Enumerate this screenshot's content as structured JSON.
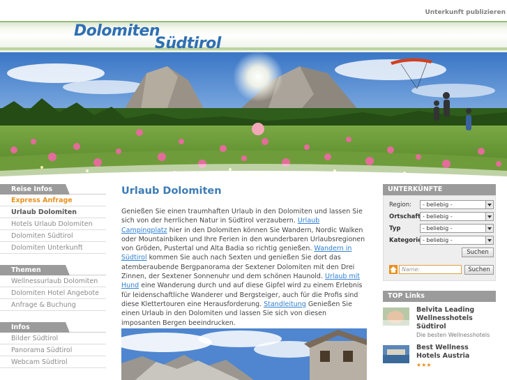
{
  "header": {
    "publish_link": "Unterkunft publizieren",
    "logo_line1": "Dolomiten",
    "logo_line2": "Südtirol"
  },
  "leftnav": {
    "sections": [
      {
        "title": "Reise Infos",
        "items": [
          "Express Anfrage",
          "Urlaub Dolomiten",
          "Hotels Urlaub Dolomiten",
          "Dolomiten Südtirol",
          "Dolomiten Unterkunft"
        ]
      },
      {
        "title": "Themen",
        "items": [
          "Wellnessurlaub Dolomiten",
          "Dolomiten Hotel Angebote",
          "Anfrage & Buchung"
        ]
      },
      {
        "title": "Infos",
        "items": [
          "Bilder Südtirol",
          "Panorama Südtirol",
          "Webcam Südtirol"
        ]
      }
    ]
  },
  "main": {
    "title": "Urlaub Dolomiten",
    "t1": "Genießen Sie einen traumhaften Urlaub in den Dolomiten und lassen Sie sich von der herrlichen Natur in Südtirol verzaubern. ",
    "l1": "Urlaub Campingplatz",
    "t2": " hier in den Dolomiten können Sie Wandern, Nordic Walken oder Mountainbiken und Ihre Ferien in den wunderbaren Urlaubsregionen von Gröden, Pustertal und Alta Badia so richtig genießen. ",
    "l2": "Wandern in Südtirol",
    "t3": " kommen Sie auch nach Sexten und genießen Sie dort das atemberaubende Bergpanorama der Sextener Dolomiten mit den Drei Zinnen, der Sextener Sonnenuhr und dem schönen Haunold. ",
    "l3": "Urlaub mit Hund",
    "t4": " eine Wanderung durch und auf diese Gipfel wird zu einem Erlebnis für leidenschaftliche Wanderer und Bergsteiger, auch für die Profis sind diese Klettertouren eine Herausforderung. ",
    "l4": "Standleitung",
    "t5": " Genießen Sie einen Urlaub in den Dolomiten und lassen Sie sich von diesen imposanten Bergen beeindrucken."
  },
  "search": {
    "title": "UNTERKÜNFTE",
    "region_label": "Region:",
    "ortschaft_label": "Ortschaft",
    "typ_label": "Typ",
    "kategorie_label": "Kategorie",
    "select_value": "- beliebig -",
    "search_button": "Suchen",
    "name_placeholder": "Name:"
  },
  "top_links": {
    "title": "TOP Links",
    "hotels": [
      {
        "name": "Belvita Leading Wellnesshotels Südtirol",
        "sub": "Die besten Wellnesshotels"
      },
      {
        "name": "Best Wellness Hotels Austria",
        "stars": "★★★"
      }
    ]
  },
  "colors": {
    "accent_blue": "#3c7cb5",
    "nav_orange": "#e9911d",
    "header_gray": "#9b9b9b"
  }
}
